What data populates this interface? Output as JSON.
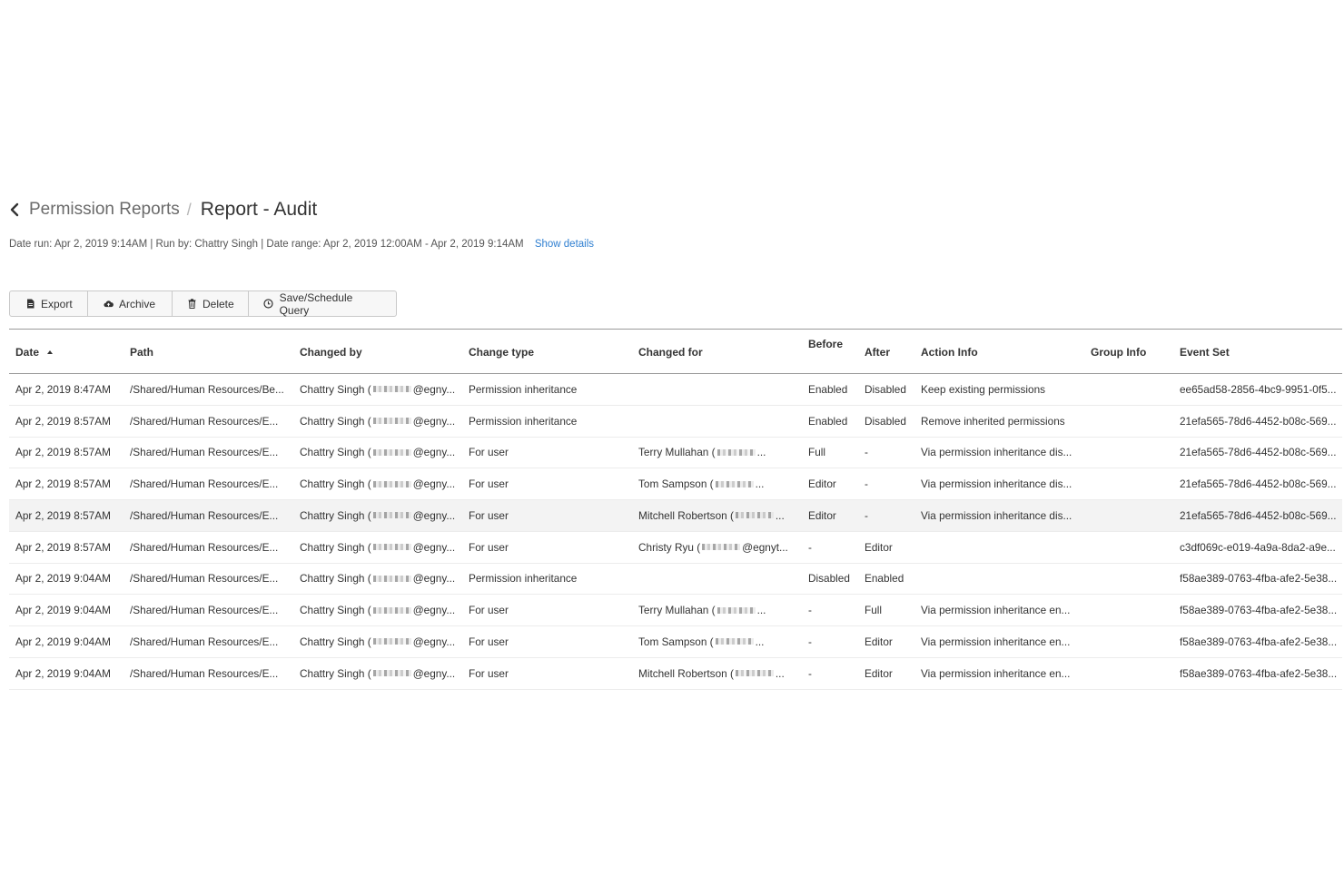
{
  "breadcrumb": {
    "parent": "Permission Reports",
    "separator": "/",
    "current": "Report - Audit"
  },
  "meta": {
    "text": "Date run: Apr 2, 2019 9:14AM | Run by: Chattry Singh | Date range: Apr 2, 2019 12:00AM - Apr 2, 2019 9:14AM",
    "show_details": "Show details"
  },
  "toolbar": {
    "export": "Export",
    "archive": "Archive",
    "delete": "Delete",
    "save_schedule": "Save/Schedule Query"
  },
  "table": {
    "columns": {
      "date": "Date",
      "path": "Path",
      "changed_by": "Changed by",
      "change_type": "Change type",
      "changed_for": "Changed for",
      "before": "Before",
      "after": "After",
      "action_info": "Action Info",
      "group_info": "Group Info",
      "event_set": "Event Set"
    },
    "rows": [
      {
        "date": "Apr 2, 2019 8:47AM",
        "path": "/Shared/Human Resources/Be...",
        "changed_by_name": "Chattry Singh (",
        "changed_by_email": "@egny...",
        "change_type": "Permission inheritance",
        "changed_for_name": "",
        "changed_for_email": "",
        "before": "Enabled",
        "after": "Disabled",
        "action_info": "Keep existing permissions",
        "group_info": "",
        "event_set": "ee65ad58-2856-4bc9-9951-0f5..."
      },
      {
        "date": "Apr 2, 2019 8:57AM",
        "path": "/Shared/Human Resources/E...",
        "changed_by_name": "Chattry Singh (",
        "changed_by_email": "@egny...",
        "change_type": "Permission inheritance",
        "changed_for_name": "",
        "changed_for_email": "",
        "before": "Enabled",
        "after": "Disabled",
        "action_info": "Remove inherited permissions",
        "group_info": "",
        "event_set": "21efa565-78d6-4452-b08c-569..."
      },
      {
        "date": "Apr 2, 2019 8:57AM",
        "path": "/Shared/Human Resources/E...",
        "changed_by_name": "Chattry Singh (",
        "changed_by_email": "@egny...",
        "change_type": "For user",
        "changed_for_name": "Terry Mullahan (",
        "changed_for_email": "...",
        "before": "Full",
        "after": "-",
        "action_info": "Via permission inheritance dis...",
        "group_info": "",
        "event_set": "21efa565-78d6-4452-b08c-569..."
      },
      {
        "date": "Apr 2, 2019 8:57AM",
        "path": "/Shared/Human Resources/E...",
        "changed_by_name": "Chattry Singh (",
        "changed_by_email": "@egny...",
        "change_type": "For user",
        "changed_for_name": "Tom Sampson (",
        "changed_for_email": "...",
        "before": "Editor",
        "after": "-",
        "action_info": "Via permission inheritance dis...",
        "group_info": "",
        "event_set": "21efa565-78d6-4452-b08c-569..."
      },
      {
        "date": "Apr 2, 2019 8:57AM",
        "path": "/Shared/Human Resources/E...",
        "changed_by_name": "Chattry Singh (",
        "changed_by_email": "@egny...",
        "change_type": "For user",
        "changed_for_name": "Mitchell Robertson (",
        "changed_for_email": "...",
        "before": "Editor",
        "after": "-",
        "action_info": "Via permission inheritance dis...",
        "group_info": "",
        "event_set": "21efa565-78d6-4452-b08c-569..."
      },
      {
        "date": "Apr 2, 2019 8:57AM",
        "path": "/Shared/Human Resources/E...",
        "changed_by_name": "Chattry Singh (",
        "changed_by_email": "@egny...",
        "change_type": "For user",
        "changed_for_name": "Christy Ryu (",
        "changed_for_email": "@egnyt...",
        "before": "-",
        "after": "Editor",
        "action_info": "",
        "group_info": "",
        "event_set": "c3df069c-e019-4a9a-8da2-a9e..."
      },
      {
        "date": "Apr 2, 2019 9:04AM",
        "path": "/Shared/Human Resources/E...",
        "changed_by_name": "Chattry Singh (",
        "changed_by_email": "@egny...",
        "change_type": "Permission inheritance",
        "changed_for_name": "",
        "changed_for_email": "",
        "before": "Disabled",
        "after": "Enabled",
        "action_info": "",
        "group_info": "",
        "event_set": "f58ae389-0763-4fba-afe2-5e38..."
      },
      {
        "date": "Apr 2, 2019 9:04AM",
        "path": "/Shared/Human Resources/E...",
        "changed_by_name": "Chattry Singh (",
        "changed_by_email": "@egny...",
        "change_type": "For user",
        "changed_for_name": "Terry Mullahan (",
        "changed_for_email": "...",
        "before": "-",
        "after": "Full",
        "action_info": "Via permission inheritance en...",
        "group_info": "",
        "event_set": "f58ae389-0763-4fba-afe2-5e38..."
      },
      {
        "date": "Apr 2, 2019 9:04AM",
        "path": "/Shared/Human Resources/E...",
        "changed_by_name": "Chattry Singh (",
        "changed_by_email": "@egny...",
        "change_type": "For user",
        "changed_for_name": "Tom Sampson (",
        "changed_for_email": "...",
        "before": "-",
        "after": "Editor",
        "action_info": "Via permission inheritance en...",
        "group_info": "",
        "event_set": "f58ae389-0763-4fba-afe2-5e38..."
      },
      {
        "date": "Apr 2, 2019 9:04AM",
        "path": "/Shared/Human Resources/E...",
        "changed_by_name": "Chattry Singh (",
        "changed_by_email": "@egny...",
        "change_type": "For user",
        "changed_for_name": "Mitchell Robertson (",
        "changed_for_email": "...",
        "before": "-",
        "after": "Editor",
        "action_info": "Via permission inheritance en...",
        "group_info": "",
        "event_set": "f58ae389-0763-4fba-afe2-5e38..."
      }
    ],
    "highlighted_row": 4
  },
  "icons": {
    "back": "chevron-left-icon",
    "export": "file-icon",
    "archive": "cloud-upload-icon",
    "delete": "trash-icon",
    "save_schedule": "clock-icon",
    "sort": "sort-ascending-icon"
  },
  "colors": {
    "link": "#2f7fd1",
    "highlight_row": "#f3f3f3",
    "border": "#9a9a9a"
  }
}
